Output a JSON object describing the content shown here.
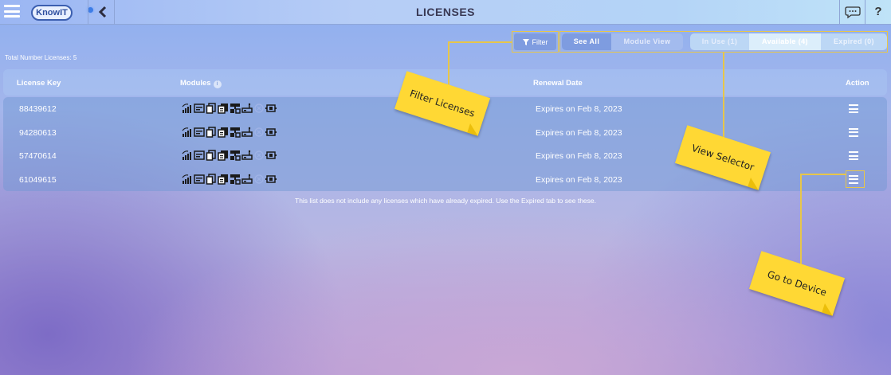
{
  "header": {
    "title": "LICENSES",
    "logo_text": "KnowIT",
    "help_label": "?"
  },
  "toolbar": {
    "filter_label": "Filter",
    "view_tabs": [
      "See All",
      "Module View"
    ],
    "status_tabs": [
      "In Use (1)",
      "Available (4)",
      "Expired (0)"
    ],
    "selected_view": "See All",
    "selected_status": "Available (4)"
  },
  "total_label": "Total Number Licenses: 5",
  "table": {
    "columns": [
      "License Key",
      "Modules",
      "Renewal Date",
      "Action"
    ],
    "rows": [
      {
        "key": "88439612",
        "renewal": "Expires on Feb 8, 2023"
      },
      {
        "key": "94280613",
        "renewal": "Expires on Feb 8, 2023"
      },
      {
        "key": "57470614",
        "renewal": "Expires on Feb 8, 2023"
      },
      {
        "key": "61049615",
        "renewal": "Expires on Feb 8, 2023"
      }
    ],
    "module_icons": [
      "signal-bars-icon",
      "monitor-icon",
      "copy-icon",
      "documents-icon",
      "network-icon",
      "device-icon",
      "sync-icon",
      "battery-icon"
    ]
  },
  "footnote": "This list does not include any licenses which have already expired. Use the Expired tab to see these.",
  "annotations": {
    "filter": "Filter Licenses",
    "view": "View Selector",
    "device": "Go to Device"
  },
  "colors": {
    "accent": "#7e9ce0",
    "sticky": "#ffd834",
    "highlight": "#e7c64a"
  }
}
